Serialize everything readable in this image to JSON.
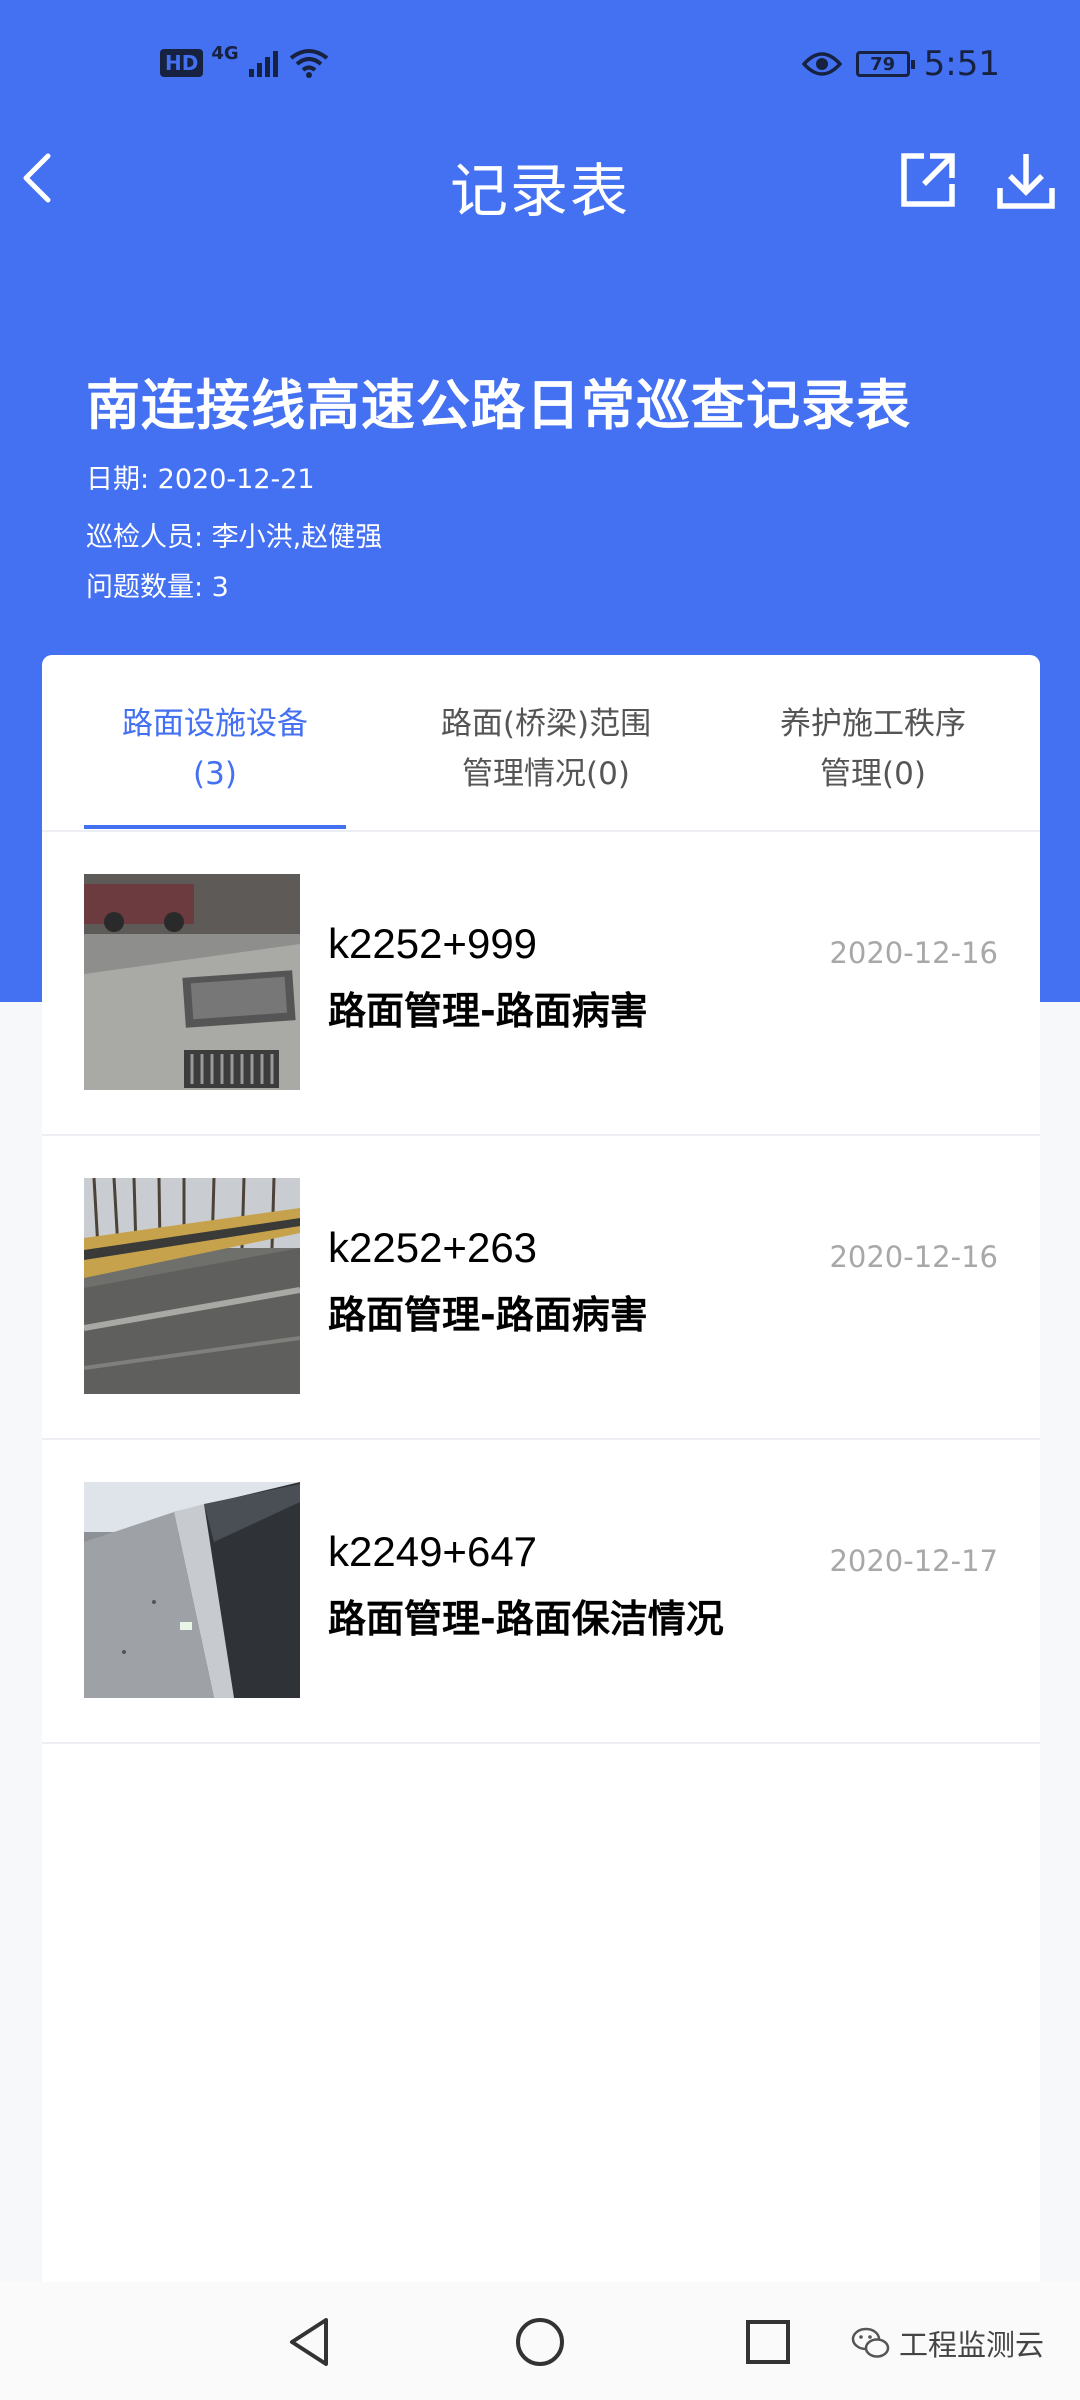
{
  "status_bar": {
    "hd_badge": "HD",
    "network": "4G",
    "battery": "79",
    "time": "5:51"
  },
  "header": {
    "title": "记录表"
  },
  "report": {
    "title": "南连接线高速公路日常巡查记录表",
    "date_line": "日期: 2020-12-21",
    "inspectors_line": "巡检人员: 李小洪,赵健强",
    "issue_count_line": "问题数量: 3"
  },
  "tabs": [
    {
      "line1": "路面设施设备",
      "line2": "(3)",
      "active": true
    },
    {
      "line1": "路面(桥梁)范围",
      "line2": "管理情况(0)",
      "active": false
    },
    {
      "line1": "养护施工秩序",
      "line2": "管理(0)",
      "active": false
    }
  ],
  "records": [
    {
      "code": "k2252+999",
      "category": "路面管理-路面病害",
      "date": "2020-12-16",
      "thumb": "road-drain-photo"
    },
    {
      "code": "k2252+263",
      "category": "路面管理-路面病害",
      "date": "2020-12-16",
      "thumb": "road-guardrail-photo"
    },
    {
      "code": "k2249+647",
      "category": "路面管理-路面保洁情况",
      "date": "2020-12-17",
      "thumb": "road-barrier-photo"
    }
  ],
  "watermark": {
    "text": "工程监测云"
  },
  "colors": {
    "primary": "#4470f2",
    "status_text": "#16223f",
    "date_gray": "#a8a8a8",
    "divider": "#eceef1"
  },
  "icons": [
    "back-arrow-icon",
    "share-icon",
    "download-icon",
    "eye-icon",
    "wifi-icon",
    "signal-icon",
    "nav-back-icon",
    "nav-home-icon",
    "nav-recents-icon",
    "wechat-icon"
  ]
}
